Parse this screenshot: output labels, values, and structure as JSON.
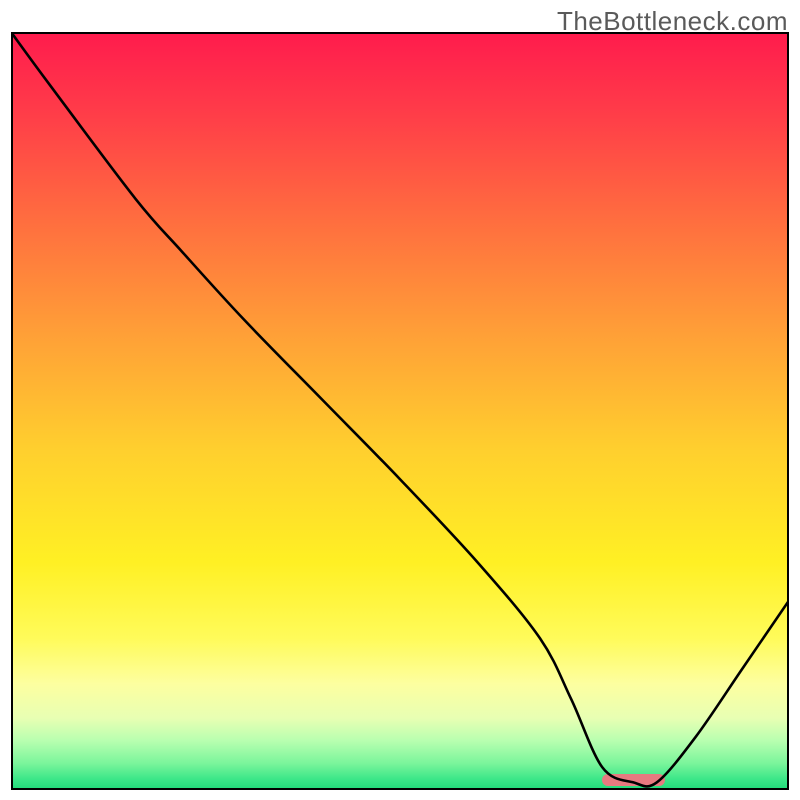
{
  "watermark": "TheBottleneck.com",
  "chart_data": {
    "type": "line",
    "title": "",
    "xlabel": "",
    "ylabel": "",
    "xlim": [
      0,
      100
    ],
    "ylim": [
      0,
      100
    ],
    "grid": false,
    "legend": false,
    "notes": "Axes are unlabeled; x and y are normalized 0–100. y represents a bottleneck-like metric that starts high (red region) and falls toward 0 (green band at bottom). The curve dips to ~0 near x≈76–82 and rises again.",
    "series": [
      {
        "name": "curve",
        "x": [
          0,
          5,
          16,
          22,
          30,
          40,
          50,
          60,
          68,
          72,
          76,
          80,
          83,
          88,
          94,
          100
        ],
        "values": [
          100,
          93,
          78,
          71,
          62,
          51.5,
          41,
          30,
          20,
          12,
          3,
          1,
          1,
          7,
          16,
          25
        ]
      }
    ],
    "marker": {
      "description": "small pink rounded bar on x-axis indicating optimal zone",
      "x_start": 76,
      "x_end": 84,
      "color": "#e77a80"
    },
    "background_gradient": [
      {
        "pos": 0.0,
        "color": "#ff1b4d"
      },
      {
        "pos": 0.1,
        "color": "#ff3a49"
      },
      {
        "pos": 0.25,
        "color": "#ff6e3f"
      },
      {
        "pos": 0.4,
        "color": "#ffa037"
      },
      {
        "pos": 0.55,
        "color": "#ffcf2e"
      },
      {
        "pos": 0.7,
        "color": "#fff024"
      },
      {
        "pos": 0.8,
        "color": "#fffb5a"
      },
      {
        "pos": 0.86,
        "color": "#fdffa0"
      },
      {
        "pos": 0.905,
        "color": "#e8ffb3"
      },
      {
        "pos": 0.935,
        "color": "#b8ffb0"
      },
      {
        "pos": 0.965,
        "color": "#7af59b"
      },
      {
        "pos": 0.985,
        "color": "#3de789"
      },
      {
        "pos": 1.0,
        "color": "#1fd979"
      }
    ]
  }
}
